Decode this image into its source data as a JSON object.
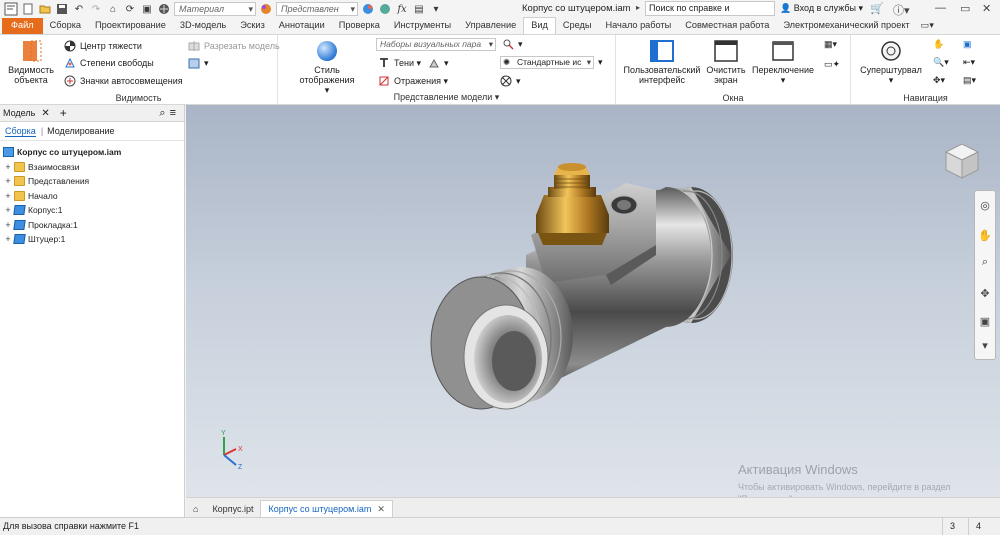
{
  "quick_access": {
    "material_placeholder": "Материал",
    "appearance_placeholder": "Представлен"
  },
  "title": {
    "document": "Корпус со штуцером.iam",
    "help_search": "Поиск по справке и командам...",
    "sign_in": "Вход в службы"
  },
  "tabs": [
    {
      "label": "Файл"
    },
    {
      "label": "Сборка"
    },
    {
      "label": "Проектирование"
    },
    {
      "label": "3D-модель"
    },
    {
      "label": "Эскиз"
    },
    {
      "label": "Аннотации"
    },
    {
      "label": "Проверка"
    },
    {
      "label": "Инструменты"
    },
    {
      "label": "Управление"
    },
    {
      "label": "Вид"
    },
    {
      "label": "Среды"
    },
    {
      "label": "Начало работы"
    },
    {
      "label": "Совместная работа"
    },
    {
      "label": "Электромеханический проект"
    }
  ],
  "ribbon": {
    "visibility": {
      "title": "Видимость",
      "object_visibility": "Видимость объекта",
      "center_of_gravity": "Центр тяжести",
      "degrees_of_freedom": "Степени свободы",
      "auto_constraint_icons": "Значки автосовмещения",
      "slice_model": "Разрезать модель"
    },
    "appearance": {
      "title": "Представление модели",
      "visual_style": "Стиль отображения",
      "visual_style_presets": "Наборы визуальных пара",
      "shadows": "Тени",
      "reflections": "Отражения",
      "standard_lighting": "Стандартные ис"
    },
    "windows": {
      "title": "Окна",
      "user_interface": "Пользовательский интерфейс",
      "clean_screen": "Очистить экран",
      "switch": "Переключение"
    },
    "navigate": {
      "title": "Навигация",
      "steering_wheel": "Суперштурвал"
    }
  },
  "browser": {
    "header": "Модель",
    "tab_assembly": "Сборка",
    "tab_modeling": "Моделирование",
    "root": "Корпус со штуцером.iam",
    "items": [
      {
        "label": "Взаимосвязи",
        "icon": "folder"
      },
      {
        "label": "Представления",
        "icon": "folder"
      },
      {
        "label": "Начало",
        "icon": "folder"
      },
      {
        "label": "Корпус:1",
        "icon": "part"
      },
      {
        "label": "Прокладка:1",
        "icon": "part"
      },
      {
        "label": "Штуцер:1",
        "icon": "part"
      }
    ]
  },
  "viewport": {
    "watermark_title": "Активация Windows",
    "watermark_text": "Чтобы активировать Windows, перейдите в раздел \"Параметры\"."
  },
  "document_tabs": [
    {
      "label": "Корпус.ipt",
      "active": false
    },
    {
      "label": "Корпус со штуцером.iam",
      "active": true
    }
  ],
  "status": {
    "message": "Для вызова справки нажмите F1",
    "count_a": "3",
    "count_b": "4"
  },
  "colors": {
    "file_tab": "#e66c1c",
    "accent": "#1565c0"
  }
}
